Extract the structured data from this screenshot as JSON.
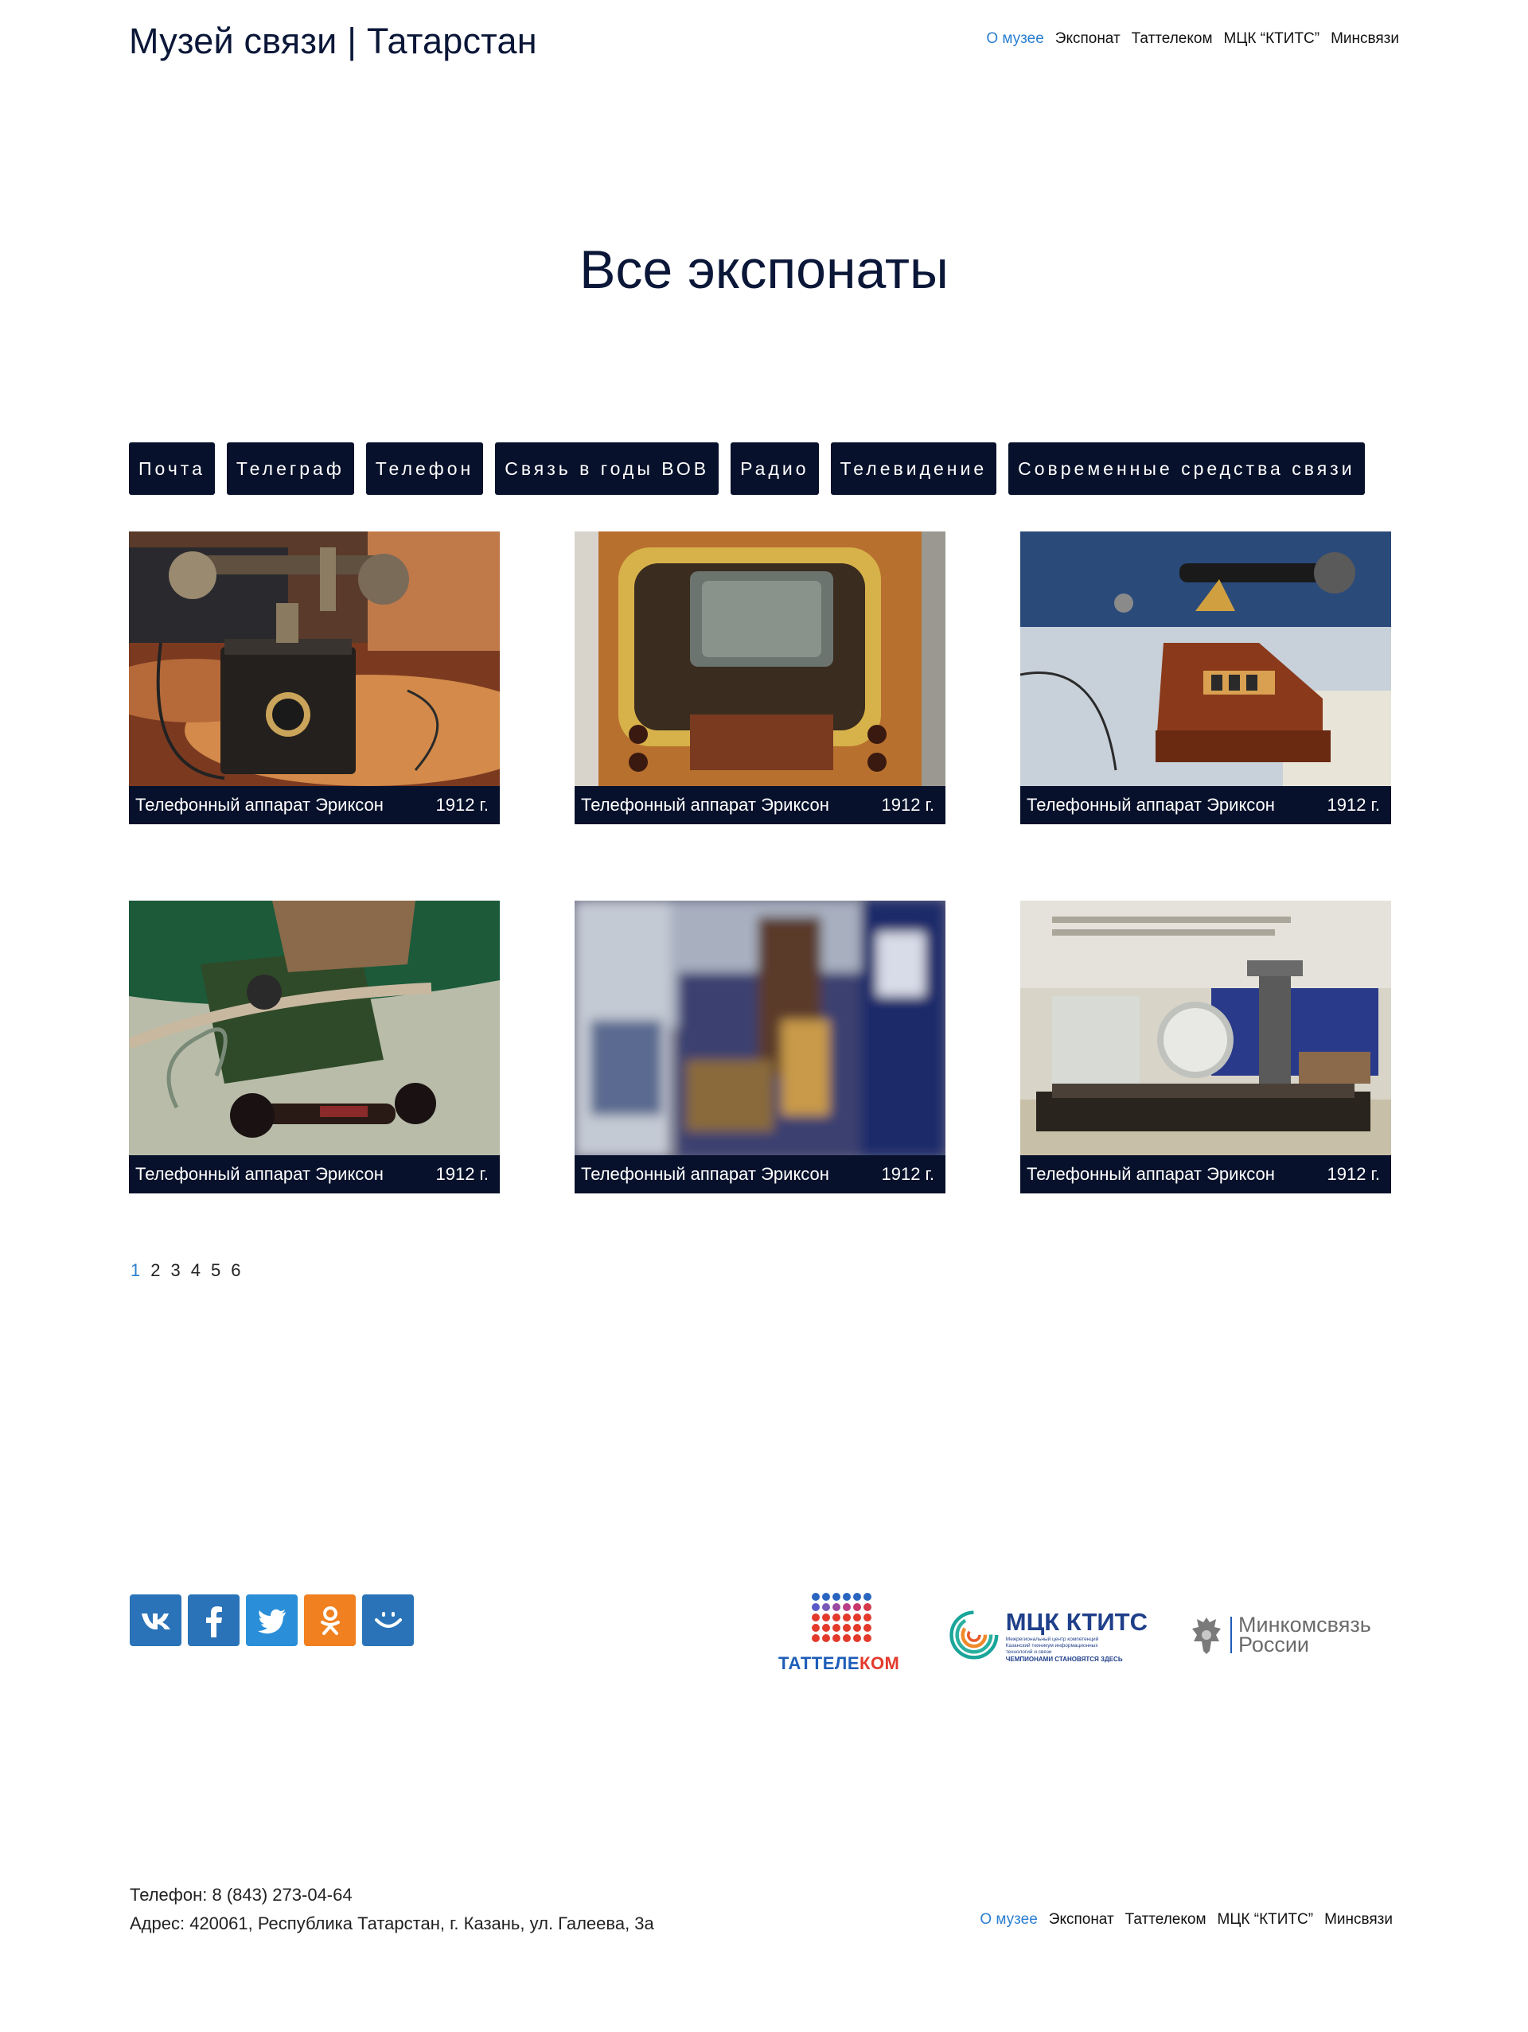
{
  "site": {
    "title": "Музей связи | Татарстан"
  },
  "nav": [
    {
      "label": "О музее",
      "active": true
    },
    {
      "label": "Экспонат",
      "active": false
    },
    {
      "label": "Таттелеком",
      "active": false
    },
    {
      "label": "МЦК “КТИТС”",
      "active": false
    },
    {
      "label": "Минсвязи",
      "active": false
    }
  ],
  "page": {
    "heading": "Все экспонаты"
  },
  "categories": [
    "Почта",
    "Телеграф",
    "Телефон",
    "Связь в годы ВОВ",
    "Радио",
    "Телевидение",
    "Современные средства связи"
  ],
  "exhibits": [
    {
      "title": "Телефонный аппарат Эриксон",
      "year": "1912 г.",
      "image": "wall-telephone-photo"
    },
    {
      "title": "Телефонный аппарат Эриксон",
      "year": "1912 г.",
      "image": "television-photo"
    },
    {
      "title": "Телефонный аппарат Эриксон",
      "year": "1912 г.",
      "image": "switchboard-telephone-photo"
    },
    {
      "title": "Телефонный аппарат Эриксон",
      "year": "1912 г.",
      "image": "field-telephone-photo"
    },
    {
      "title": "Телефонный аппарат Эриксон",
      "year": "1912 г.",
      "image": "museum-room-photo"
    },
    {
      "title": "Телефонный аппарат Эриксон",
      "year": "1912 г.",
      "image": "telegraph-apparatus-photo"
    }
  ],
  "pagination": {
    "pages": [
      "1",
      "2",
      "3",
      "4",
      "5",
      "6"
    ],
    "current": "1"
  },
  "socials": [
    {
      "name": "vk-icon",
      "color": "#2a73b8"
    },
    {
      "name": "facebook-icon",
      "color": "#2a73b8"
    },
    {
      "name": "twitter-icon",
      "color": "#2a8fd8"
    },
    {
      "name": "odnoklassniki-icon",
      "color": "#f08020"
    },
    {
      "name": "mail-ru-icon",
      "color": "#2a73b8"
    }
  ],
  "partners": {
    "tattelecom": {
      "part1": "ТАТТЕЛЕ",
      "part2": "КОМ"
    },
    "ktits": {
      "name": "МЦК КТИТС",
      "sub_line1": "Межрегиональный центр компетенций",
      "sub_line2": "Казанский техникум информационных",
      "sub_line3": "технологий и связи",
      "slogan": "ЧЕМПИОНАМИ СТАНОВЯТСЯ ЗДЕСЬ"
    },
    "mincom": {
      "line1": "Минкомсвязь",
      "line2": "России"
    }
  },
  "contacts": {
    "phone": "Телефон: 8 (843) 273-04-64",
    "address": "Адрес: 420061, Республика Татарстан, г. Казань, ул. Галеева, 3а"
  },
  "colors": {
    "dark_navy": "#07112b",
    "accent_blue": "#2b7fd0"
  }
}
